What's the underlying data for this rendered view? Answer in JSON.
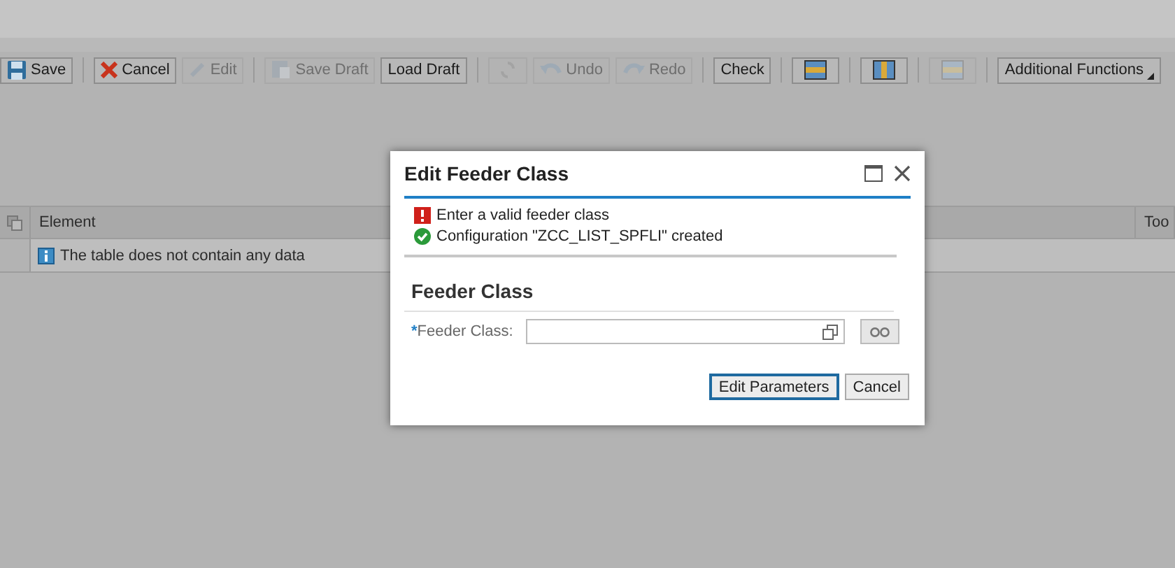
{
  "toolbar": [
    {
      "kind": "button",
      "label": "Save",
      "disabled": false
    },
    {
      "kind": "separator"
    },
    {
      "kind": "button",
      "label": "Cancel",
      "disabled": false
    },
    {
      "kind": "button",
      "label": "Edit",
      "disabled": true
    },
    {
      "kind": "separator"
    },
    {
      "kind": "button",
      "label": "Save Draft",
      "disabled": true
    },
    {
      "kind": "button",
      "label": "Load Draft",
      "disabled": false
    },
    {
      "kind": "separator"
    },
    {
      "kind": "icon",
      "disabled": true
    },
    {
      "kind": "button",
      "label": "Undo",
      "disabled": true
    },
    {
      "kind": "button",
      "label": "Redo",
      "disabled": true
    },
    {
      "kind": "separator"
    },
    {
      "kind": "button",
      "label": "Check",
      "disabled": false
    },
    {
      "kind": "separator"
    },
    {
      "kind": "icon",
      "disabled": false
    },
    {
      "kind": "separator"
    },
    {
      "kind": "icon",
      "disabled": false
    },
    {
      "kind": "separator"
    },
    {
      "kind": "icon",
      "disabled": true
    },
    {
      "kind": "separator"
    },
    {
      "kind": "menu",
      "label": "Additional Functions",
      "disabled": false
    }
  ],
  "table": {
    "columns": [
      "Element",
      "Too"
    ],
    "empty_message": "The table does not contain any data"
  },
  "dialog": {
    "title": "Edit Feeder Class",
    "messages": [
      {
        "kind": "error",
        "text": "Enter a valid feeder class"
      },
      {
        "kind": "success",
        "text": "Configuration \"ZCC_LIST_SPFLI\" created"
      }
    ],
    "section": "Feeder Class",
    "field": {
      "label": "Feeder Class:",
      "required_mark": "*"
    },
    "buttons": [
      {
        "label": "Edit Parameters",
        "selected": true
      },
      {
        "label": "Cancel",
        "selected": false
      }
    ]
  }
}
